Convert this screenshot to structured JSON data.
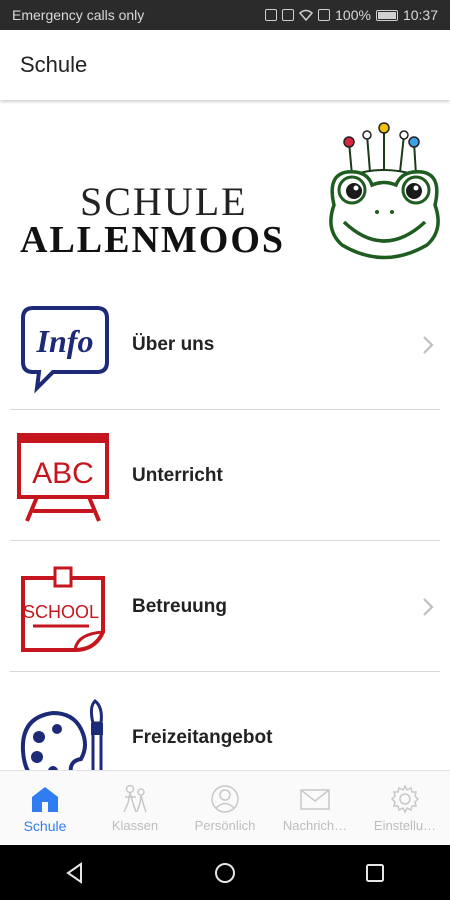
{
  "status_bar": {
    "carrier_text": "Emergency calls only",
    "battery_percent": "100%",
    "time": "10:37",
    "icons": [
      "nfc-icon",
      "vibrate-icon",
      "wifi-icon",
      "sim-icon",
      "battery-icon"
    ]
  },
  "app_bar": {
    "title": "Schule"
  },
  "banner": {
    "logo_line1": "SCHULE",
    "logo_line2": "ALLENMOOS",
    "mascot_icon": "frog-mascot-icon"
  },
  "menu": {
    "items": [
      {
        "label": "Über uns",
        "icon": "info-speech-bubble-icon",
        "has_chevron": true
      },
      {
        "label": "Unterricht",
        "icon": "abc-chalkboard-icon",
        "has_chevron": false
      },
      {
        "label": "Betreuung",
        "icon": "school-note-icon",
        "has_chevron": true
      },
      {
        "label": "Freizeitangebot",
        "icon": "paint-palette-icon",
        "has_chevron": false
      }
    ]
  },
  "tab_bar": {
    "tabs": [
      {
        "label": "Schule",
        "icon": "school-house-icon",
        "active": true
      },
      {
        "label": "Klassen",
        "icon": "children-icon",
        "active": false
      },
      {
        "label": "Persönlich",
        "icon": "person-icon",
        "active": false
      },
      {
        "label": "Nachrich…",
        "icon": "envelope-icon",
        "active": false
      },
      {
        "label": "Einstellu…",
        "icon": "gear-icon",
        "active": false
      }
    ],
    "active_color": "#2f7df2",
    "inactive_color": "#bdbdbd"
  },
  "nav_bar": {
    "buttons": [
      "back-icon",
      "home-icon",
      "recents-icon"
    ]
  }
}
